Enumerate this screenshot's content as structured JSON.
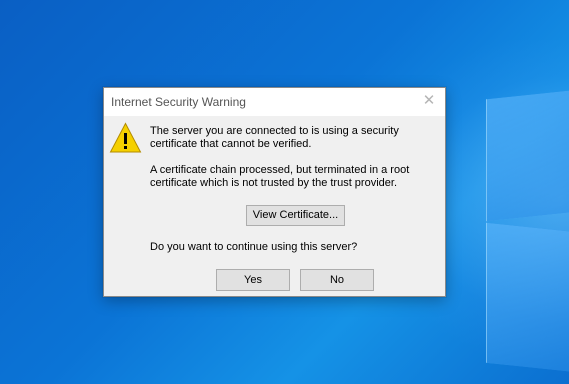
{
  "desktop": {
    "background_color": "#0b74d6"
  },
  "dialog": {
    "title": "Internet Security Warning",
    "close_icon": "close-icon",
    "icon": "warning-icon",
    "message_1": "The server you are connected to is using a security certificate that cannot be verified.",
    "message_2": "A certificate chain processed, but terminated in a root certificate which is not trusted by the trust provider.",
    "view_certificate_label": "View Certificate...",
    "question": "Do you want to continue using this server?",
    "yes_label": "Yes",
    "no_label": "No"
  }
}
